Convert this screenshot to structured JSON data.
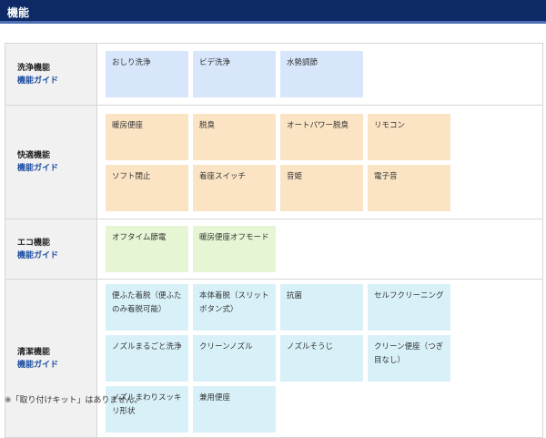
{
  "header": {
    "title": "機能"
  },
  "categories": [
    {
      "name": "洗浄機能",
      "guide": "機能ガイド",
      "items": [
        "おしり洗浄",
        "ビデ洗浄",
        "水勢調節"
      ]
    },
    {
      "name": "快適機能",
      "guide": "機能ガイド",
      "items": [
        "暖房便座",
        "脱臭",
        "オートパワー脱臭",
        "リモコン",
        "ソフト閉止",
        "着座スイッチ",
        "音姫",
        "電子音"
      ]
    },
    {
      "name": "エコ機能",
      "guide": "機能ガイド",
      "items": [
        "オフタイム節電",
        "暖房便座オフモード"
      ]
    },
    {
      "name": "清潔機能",
      "guide": "機能ガイド",
      "items": [
        "便ふた着脱（便ふたのみ着脱可能）",
        "本体着脱（スリットボタン式）",
        "抗菌",
        "セルフクリーニング",
        "ノズルまるごと洗浄",
        "クリーンノズル",
        "ノズルそうじ",
        "クリーン便座（つぎ目なし）",
        "ノズルまわりスッキリ形状",
        "兼用便座"
      ]
    }
  ],
  "footnote": "※「取り付けキット」はありません。",
  "colors": {
    "header_bg": "#0d2a66",
    "wash": "#d7e6fb",
    "comfort": "#fbe4c4",
    "eco": "#e6f5d3",
    "clean": "#d8f1f9",
    "guide_link": "#1d4fa1"
  }
}
